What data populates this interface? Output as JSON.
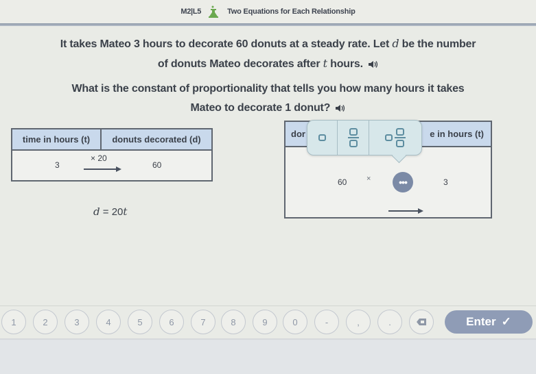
{
  "header": {
    "lesson": "M2|L5",
    "icon": "flask-icon",
    "title": "Two Equations for Each Relationship",
    "accent_color": "#6aa84f"
  },
  "prompt": {
    "line1": "It takes Mateo 3 hours to decorate 60 donuts at a steady rate. Let d be the number",
    "line1_parts": {
      "a": "It takes Mateo 3 hours to decorate 60 donuts at a steady rate. Let ",
      "var": "d",
      "b": " be the number"
    },
    "line2_parts": {
      "a": "of donuts Mateo decorates after ",
      "var": "t",
      "b": " hours."
    },
    "question_line1": "What is the constant of proportionality that tells you how many hours it takes",
    "question_line2": "Mateo to decorate 1 donut?"
  },
  "left_table": {
    "headers": [
      "time in hours (t)",
      "donuts decorated (d)"
    ],
    "row": {
      "left": "3",
      "multiplier": "× 20",
      "right": "60"
    }
  },
  "equation": {
    "lhs": "d",
    "op": " = 20",
    "var": "t"
  },
  "right_table": {
    "headers": [
      "dor",
      "e in hours (t)"
    ],
    "row": {
      "left": "60",
      "times": "×",
      "right": "3"
    },
    "more_button": "•••"
  },
  "popover": {
    "options": [
      "whole-number-box",
      "fraction-box",
      "mixed-number-box"
    ]
  },
  "keypad": {
    "keys": [
      "1",
      "2",
      "3",
      "4",
      "5",
      "6",
      "7",
      "8",
      "9",
      "0",
      "-",
      ",",
      ".",
      "⌫"
    ],
    "enter_label": "Enter",
    "enter_icon": "✓"
  },
  "colors": {
    "table_header": "#c9d9ec",
    "enter_button": "#8f9cb6",
    "more_button": "#7b8aa6",
    "popover": "#d7e7ea"
  }
}
